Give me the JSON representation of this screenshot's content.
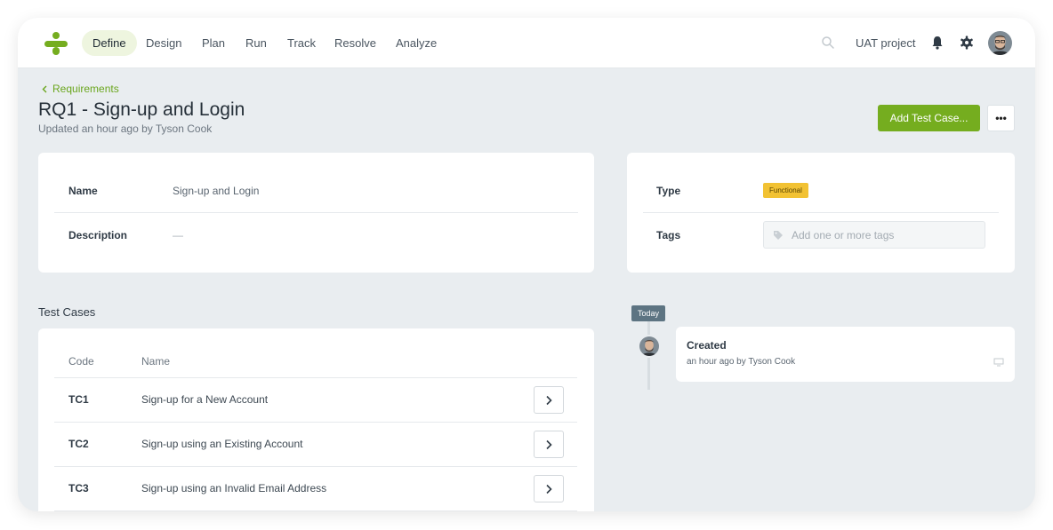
{
  "nav": {
    "items": [
      {
        "label": "Define",
        "active": true
      },
      {
        "label": "Design",
        "active": false
      },
      {
        "label": "Plan",
        "active": false
      },
      {
        "label": "Run",
        "active": false
      },
      {
        "label": "Track",
        "active": false
      },
      {
        "label": "Resolve",
        "active": false
      },
      {
        "label": "Analyze",
        "active": false
      }
    ],
    "project": "UAT project",
    "icons": [
      "search-icon",
      "bell-icon",
      "gear-icon",
      "avatar"
    ]
  },
  "header": {
    "back_label": "Requirements",
    "title": "RQ1 - Sign-up and Login",
    "subtitle": "Updated an hour ago by Tyson Cook",
    "add_button": "Add Test Case...",
    "more_button": "•••"
  },
  "details": {
    "name_label": "Name",
    "name_value": "Sign-up and Login",
    "description_label": "Description",
    "description_value": "—"
  },
  "meta": {
    "type_label": "Type",
    "type_value": "Functional",
    "tags_label": "Tags",
    "tags_placeholder": "Add one or more tags"
  },
  "test_cases": {
    "section_title": "Test Cases",
    "columns": [
      "Code",
      "Name"
    ],
    "rows": [
      {
        "code": "TC1",
        "name": "Sign-up for a New Account"
      },
      {
        "code": "TC2",
        "name": "Sign-up using an Existing Account"
      },
      {
        "code": "TC3",
        "name": "Sign-up using an Invalid Email Address"
      }
    ]
  },
  "timeline": {
    "today_label": "Today",
    "event_title": "Created",
    "event_sub": "an hour ago by Tyson Cook"
  },
  "colors": {
    "accent": "#75ad1f",
    "badge": "#f2c233",
    "background": "#e9edf0"
  }
}
